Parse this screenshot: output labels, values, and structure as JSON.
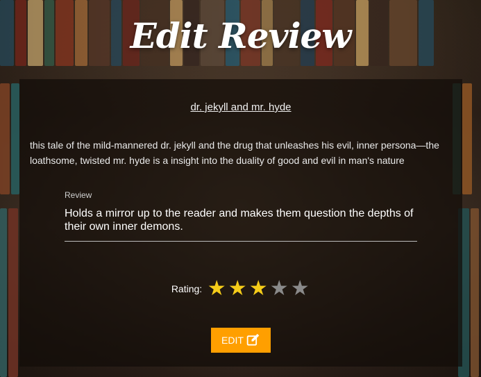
{
  "page": {
    "title": "Edit Review"
  },
  "book": {
    "title": "dr. jekyll and mr. hyde",
    "description": "this tale of the mild-mannered dr. jekyll and the drug that unleashes his evil, inner persona—the loathsome, twisted mr. hyde is a insight into the duality of good and evil in man's nature"
  },
  "review": {
    "label": "Review",
    "value": "Holds a mirror up to the reader and makes them question the depths of their own inner demons."
  },
  "rating": {
    "label": "Rating:",
    "value": 3,
    "max": 5,
    "star_on_color": "#f5cc19",
    "star_off_color": "#8a8a8a"
  },
  "actions": {
    "edit_label": "Edit",
    "edit_icon": "edit-square-icon",
    "edit_color": "#ff9f00"
  }
}
